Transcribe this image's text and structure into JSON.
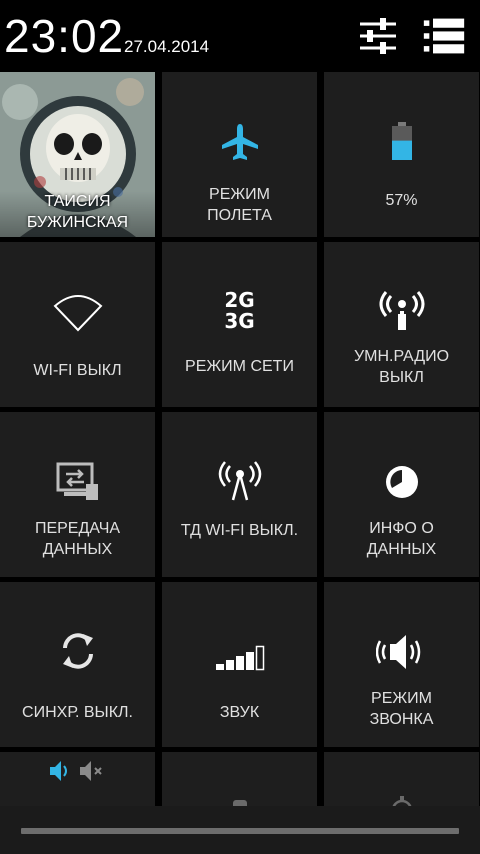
{
  "status": {
    "time": "23:02",
    "date": "27.04.2014"
  },
  "header_buttons": [
    {
      "icon": "settings-sliders-icon"
    },
    {
      "icon": "notification-list-icon"
    }
  ],
  "user": {
    "name_line1": "ТАИСИЯ",
    "name_line2": "БУЖИНСКАЯ",
    "avatar": "skull-astronaut-avatar"
  },
  "tiles": {
    "airplane": {
      "line1": "РЕЖИМ",
      "line2": "ПОЛЕТА",
      "icon": "airplane-icon",
      "accent": "#33b5e5"
    },
    "battery": {
      "label": "57%",
      "level": 0.57,
      "icon": "battery-icon",
      "accent": "#33b5e5"
    },
    "wifi": {
      "label": "WI-FI ВЫКЛ",
      "icon": "wifi-icon"
    },
    "network": {
      "label": "РЕЖИМ СЕТИ",
      "icon": "network-mode-icon",
      "icon_text1": "2G",
      "icon_text2": "3G"
    },
    "smart_radio": {
      "line1": "УМН.РАДИО",
      "line2": "ВЫКЛ",
      "icon": "smart-radio-icon"
    },
    "data_transfer": {
      "line1": "ПЕРЕДАЧА",
      "line2": "ДАННЫХ",
      "icon": "data-transfer-icon"
    },
    "hotspot": {
      "label": "ТД WI-FI ВЫКЛ.",
      "icon": "hotspot-icon"
    },
    "data_info": {
      "line1": "ИНФО О",
      "line2": "ДАННЫХ",
      "icon": "data-usage-icon"
    },
    "sync": {
      "label": "СИНХР. ВЫКЛ.",
      "icon": "sync-icon"
    },
    "sound": {
      "label": "ЗВУК",
      "icon": "volume-bars-icon"
    },
    "ring_mode": {
      "line1": "РЕЖИМ",
      "line2": "ЗВОНКА",
      "icon": "ringer-icon"
    }
  }
}
